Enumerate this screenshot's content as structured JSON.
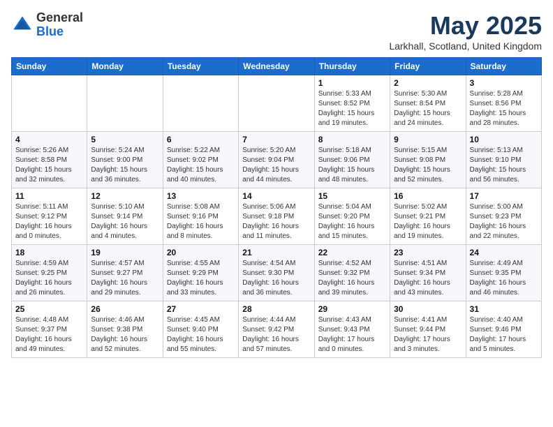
{
  "logo": {
    "general": "General",
    "blue": "Blue"
  },
  "title": {
    "month_year": "May 2025",
    "location": "Larkhall, Scotland, United Kingdom"
  },
  "headers": [
    "Sunday",
    "Monday",
    "Tuesday",
    "Wednesday",
    "Thursday",
    "Friday",
    "Saturday"
  ],
  "weeks": [
    [
      {
        "day": "",
        "detail": ""
      },
      {
        "day": "",
        "detail": ""
      },
      {
        "day": "",
        "detail": ""
      },
      {
        "day": "",
        "detail": ""
      },
      {
        "day": "1",
        "detail": "Sunrise: 5:33 AM\nSunset: 8:52 PM\nDaylight: 15 hours\nand 19 minutes."
      },
      {
        "day": "2",
        "detail": "Sunrise: 5:30 AM\nSunset: 8:54 PM\nDaylight: 15 hours\nand 24 minutes."
      },
      {
        "day": "3",
        "detail": "Sunrise: 5:28 AM\nSunset: 8:56 PM\nDaylight: 15 hours\nand 28 minutes."
      }
    ],
    [
      {
        "day": "4",
        "detail": "Sunrise: 5:26 AM\nSunset: 8:58 PM\nDaylight: 15 hours\nand 32 minutes."
      },
      {
        "day": "5",
        "detail": "Sunrise: 5:24 AM\nSunset: 9:00 PM\nDaylight: 15 hours\nand 36 minutes."
      },
      {
        "day": "6",
        "detail": "Sunrise: 5:22 AM\nSunset: 9:02 PM\nDaylight: 15 hours\nand 40 minutes."
      },
      {
        "day": "7",
        "detail": "Sunrise: 5:20 AM\nSunset: 9:04 PM\nDaylight: 15 hours\nand 44 minutes."
      },
      {
        "day": "8",
        "detail": "Sunrise: 5:18 AM\nSunset: 9:06 PM\nDaylight: 15 hours\nand 48 minutes."
      },
      {
        "day": "9",
        "detail": "Sunrise: 5:15 AM\nSunset: 9:08 PM\nDaylight: 15 hours\nand 52 minutes."
      },
      {
        "day": "10",
        "detail": "Sunrise: 5:13 AM\nSunset: 9:10 PM\nDaylight: 15 hours\nand 56 minutes."
      }
    ],
    [
      {
        "day": "11",
        "detail": "Sunrise: 5:11 AM\nSunset: 9:12 PM\nDaylight: 16 hours\nand 0 minutes."
      },
      {
        "day": "12",
        "detail": "Sunrise: 5:10 AM\nSunset: 9:14 PM\nDaylight: 16 hours\nand 4 minutes."
      },
      {
        "day": "13",
        "detail": "Sunrise: 5:08 AM\nSunset: 9:16 PM\nDaylight: 16 hours\nand 8 minutes."
      },
      {
        "day": "14",
        "detail": "Sunrise: 5:06 AM\nSunset: 9:18 PM\nDaylight: 16 hours\nand 11 minutes."
      },
      {
        "day": "15",
        "detail": "Sunrise: 5:04 AM\nSunset: 9:20 PM\nDaylight: 16 hours\nand 15 minutes."
      },
      {
        "day": "16",
        "detail": "Sunrise: 5:02 AM\nSunset: 9:21 PM\nDaylight: 16 hours\nand 19 minutes."
      },
      {
        "day": "17",
        "detail": "Sunrise: 5:00 AM\nSunset: 9:23 PM\nDaylight: 16 hours\nand 22 minutes."
      }
    ],
    [
      {
        "day": "18",
        "detail": "Sunrise: 4:59 AM\nSunset: 9:25 PM\nDaylight: 16 hours\nand 26 minutes."
      },
      {
        "day": "19",
        "detail": "Sunrise: 4:57 AM\nSunset: 9:27 PM\nDaylight: 16 hours\nand 29 minutes."
      },
      {
        "day": "20",
        "detail": "Sunrise: 4:55 AM\nSunset: 9:29 PM\nDaylight: 16 hours\nand 33 minutes."
      },
      {
        "day": "21",
        "detail": "Sunrise: 4:54 AM\nSunset: 9:30 PM\nDaylight: 16 hours\nand 36 minutes."
      },
      {
        "day": "22",
        "detail": "Sunrise: 4:52 AM\nSunset: 9:32 PM\nDaylight: 16 hours\nand 39 minutes."
      },
      {
        "day": "23",
        "detail": "Sunrise: 4:51 AM\nSunset: 9:34 PM\nDaylight: 16 hours\nand 43 minutes."
      },
      {
        "day": "24",
        "detail": "Sunrise: 4:49 AM\nSunset: 9:35 PM\nDaylight: 16 hours\nand 46 minutes."
      }
    ],
    [
      {
        "day": "25",
        "detail": "Sunrise: 4:48 AM\nSunset: 9:37 PM\nDaylight: 16 hours\nand 49 minutes."
      },
      {
        "day": "26",
        "detail": "Sunrise: 4:46 AM\nSunset: 9:38 PM\nDaylight: 16 hours\nand 52 minutes."
      },
      {
        "day": "27",
        "detail": "Sunrise: 4:45 AM\nSunset: 9:40 PM\nDaylight: 16 hours\nand 55 minutes."
      },
      {
        "day": "28",
        "detail": "Sunrise: 4:44 AM\nSunset: 9:42 PM\nDaylight: 16 hours\nand 57 minutes."
      },
      {
        "day": "29",
        "detail": "Sunrise: 4:43 AM\nSunset: 9:43 PM\nDaylight: 17 hours\nand 0 minutes."
      },
      {
        "day": "30",
        "detail": "Sunrise: 4:41 AM\nSunset: 9:44 PM\nDaylight: 17 hours\nand 3 minutes."
      },
      {
        "day": "31",
        "detail": "Sunrise: 4:40 AM\nSunset: 9:46 PM\nDaylight: 17 hours\nand 5 minutes."
      }
    ]
  ]
}
